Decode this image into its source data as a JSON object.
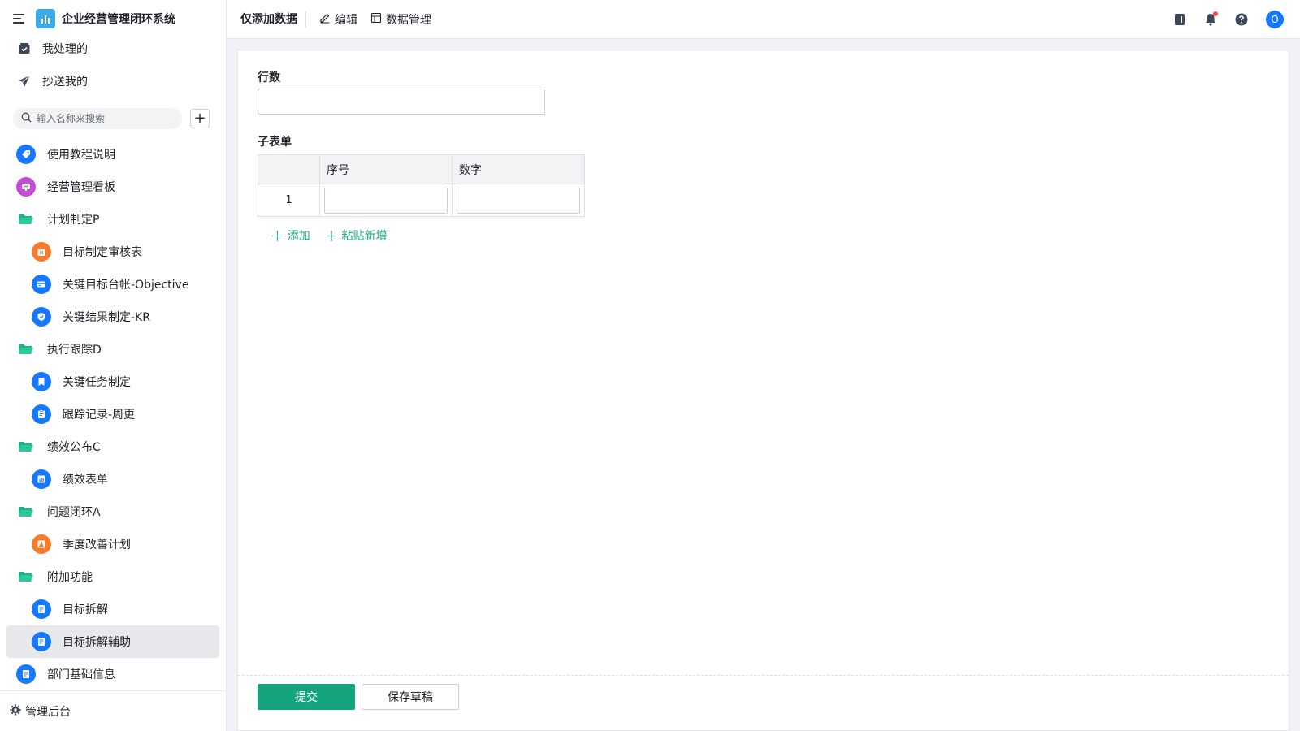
{
  "app": {
    "title": "企业经营管理闭环系统",
    "logo_color": "#3aa9e6"
  },
  "sidebar": {
    "top_items": [
      {
        "label": "我处理的",
        "icon": "inbox-check-icon"
      },
      {
        "label": "抄送我的",
        "icon": "send-icon"
      }
    ],
    "search": {
      "placeholder": "输入名称来搜索",
      "value": ""
    },
    "items": [
      {
        "label": "使用教程说明",
        "icon": "tag-icon",
        "color": "#1677ff"
      },
      {
        "label": "经营管理看板",
        "icon": "dashboard-icon",
        "color": "#c44bd6"
      },
      {
        "label": "计划制定P",
        "icon": "folder-icon"
      },
      {
        "label": "目标制定审核表",
        "icon": "calendar-icon",
        "color": "#f77b2b"
      },
      {
        "label": "关键目标台帐-Objective",
        "icon": "card-icon",
        "color": "#1677ff"
      },
      {
        "label": "关键结果制定-KR",
        "icon": "shield-check-icon",
        "color": "#1677ff"
      },
      {
        "label": "执行跟踪D",
        "icon": "folder-icon"
      },
      {
        "label": "关键任务制定",
        "icon": "bookmark-icon",
        "color": "#1677ff"
      },
      {
        "label": "跟踪记录-周更",
        "icon": "clipboard-icon",
        "color": "#1677ff"
      },
      {
        "label": "绩效公布C",
        "icon": "folder-icon"
      },
      {
        "label": "绩效表单",
        "icon": "chart-icon",
        "color": "#1677ff"
      },
      {
        "label": "问题闭环A",
        "icon": "folder-icon"
      },
      {
        "label": "季度改善计划",
        "icon": "flask-icon",
        "color": "#f77b2b"
      },
      {
        "label": "附加功能",
        "icon": "folder-icon"
      },
      {
        "label": "目标拆解",
        "icon": "document-icon",
        "color": "#1677ff"
      },
      {
        "label": "目标拆解辅助",
        "icon": "document-icon",
        "color": "#1677ff",
        "active": true
      },
      {
        "label": "部门基础信息",
        "icon": "document-icon",
        "color": "#1677ff"
      }
    ],
    "footer_label": "管理后台"
  },
  "topbar": {
    "title": "仅添加数据",
    "edit_label": "编辑",
    "data_manage_label": "数据管理",
    "avatar_letter": "O"
  },
  "form": {
    "row_count_label": "行数",
    "row_count_value": "",
    "subform_label": "子表单",
    "columns": [
      "序号",
      "数字"
    ],
    "rows": [
      {
        "index": "1",
        "seq": "",
        "number": ""
      }
    ],
    "add_label": "添加",
    "paste_add_label": "粘贴新增",
    "submit_label": "提交",
    "save_draft_label": "保存草稿"
  },
  "colors": {
    "accent": "#14a57f",
    "link": "#1ba784",
    "folder": "#18b38a"
  }
}
